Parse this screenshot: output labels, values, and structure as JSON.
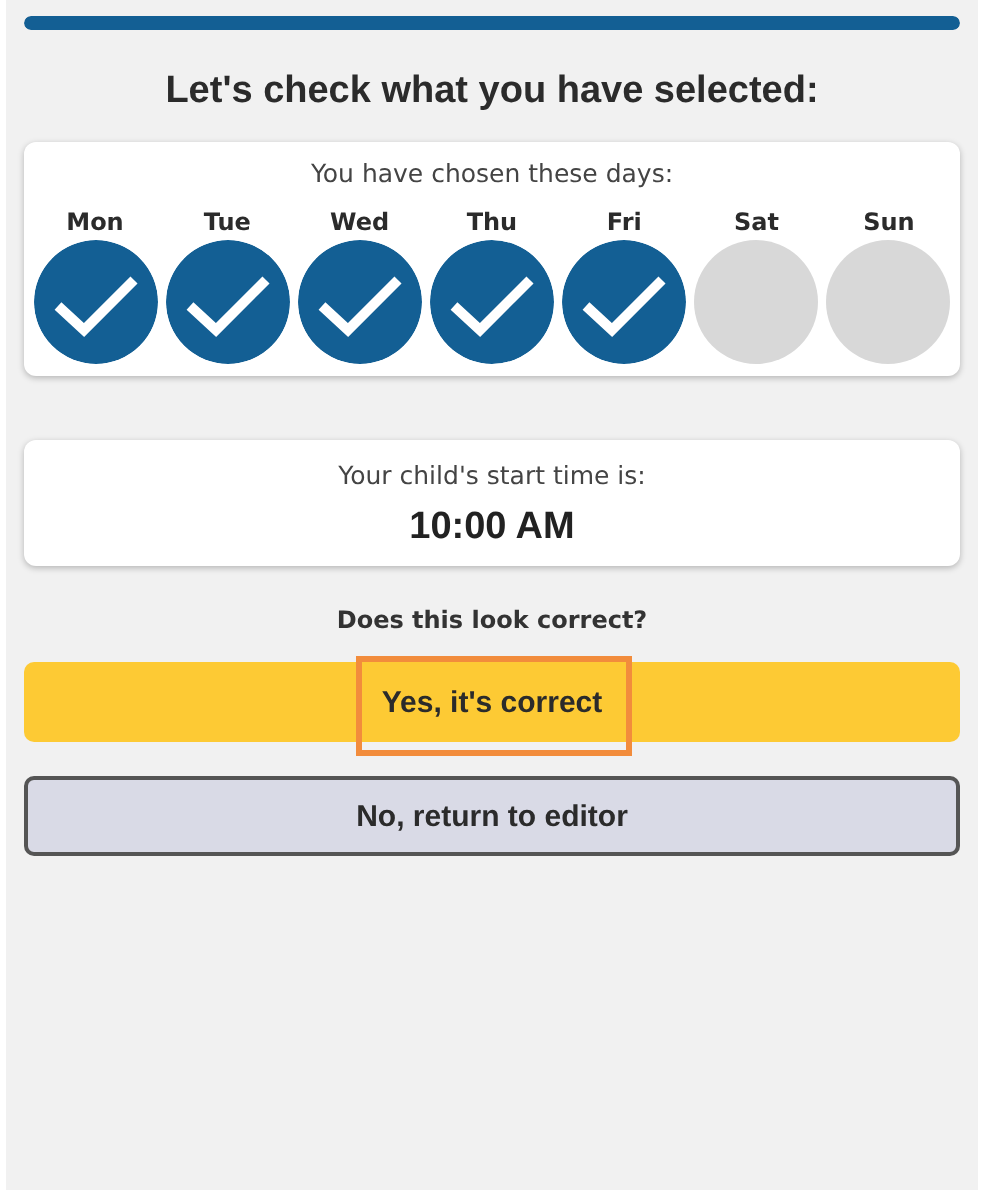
{
  "progress": {
    "level": 1
  },
  "title": "Let's check what you have selected:",
  "days_card": {
    "label": "You have chosen these days:",
    "days": [
      {
        "label": "Mon",
        "checked": true
      },
      {
        "label": "Tue",
        "checked": true
      },
      {
        "label": "Wed",
        "checked": true
      },
      {
        "label": "Thu",
        "checked": true
      },
      {
        "label": "Fri",
        "checked": true
      },
      {
        "label": "Sat",
        "checked": false
      },
      {
        "label": "Sun",
        "checked": false
      }
    ]
  },
  "time_card": {
    "label": "Your child's start time is:",
    "value": "10:00 AM"
  },
  "question": "Does this look correct?",
  "buttons": [
    {
      "label": "Yes, it's correct",
      "kind": "primary",
      "highlighted": true
    },
    {
      "label": "No, return to editor",
      "kind": "secondary",
      "highlighted": false
    }
  ]
}
